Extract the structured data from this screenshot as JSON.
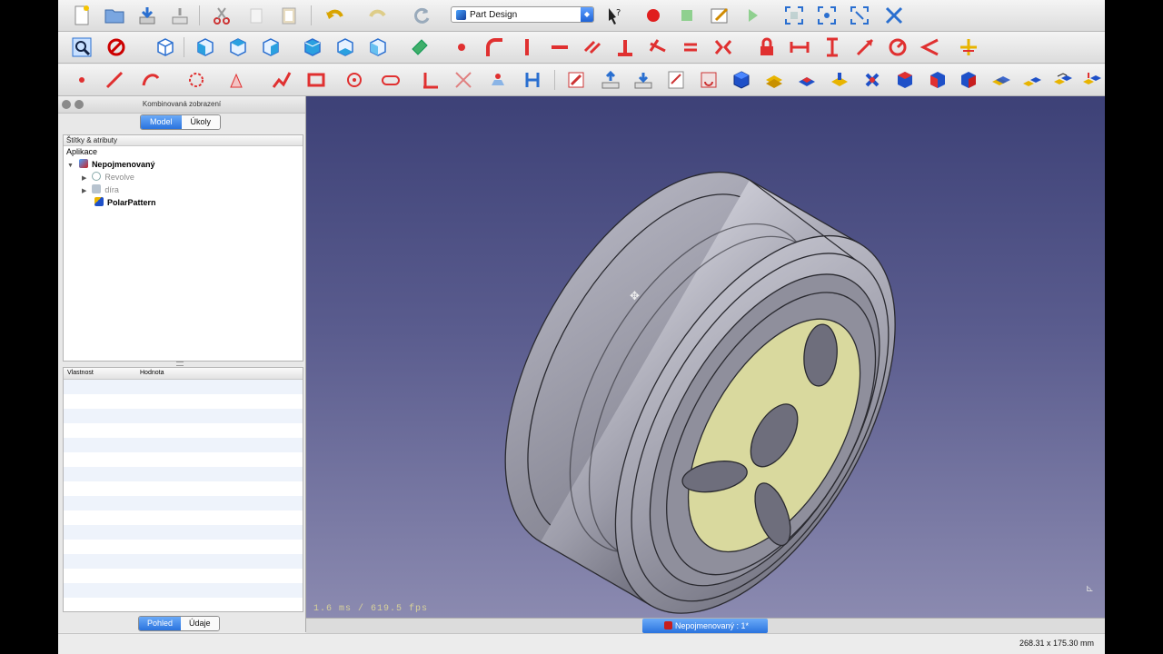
{
  "toolbar": {
    "workbench_selected": "Part Design"
  },
  "combo_view": {
    "title": "Kombinovaná zobrazení",
    "tabs": [
      "Model",
      "Úkoly"
    ],
    "active_tab": "Model",
    "tree_header": "Štítky & atributy",
    "tree_items": [
      {
        "label": "Aplikace",
        "icon": "none",
        "bold": false,
        "greyed": false
      },
      {
        "label": "Nepojmenovaný",
        "icon": "document-icon",
        "bold": true,
        "greyed": false
      },
      {
        "label": "Revolve",
        "icon": "revolve-icon",
        "bold": false,
        "greyed": true
      },
      {
        "label": "díra",
        "icon": "pocket-icon",
        "bold": false,
        "greyed": true
      },
      {
        "label": "PolarPattern",
        "icon": "polar-pattern-icon",
        "bold": true,
        "greyed": false
      }
    ],
    "property_columns": [
      "Vlastnost",
      "Hodnota"
    ],
    "bottom_tabs": [
      "Pohled",
      "Údaje"
    ],
    "bottom_active": "Pohled"
  },
  "viewport": {
    "fps_text": "1.6 ms / 619.5 fps"
  },
  "document_tab": {
    "label": "Nepojmenovaný : 1*"
  },
  "status_bar": {
    "dimensions": "268.31 x 175.30 mm"
  },
  "colors": {
    "accent": "#2a73de",
    "viewport_top": "#3d4177",
    "viewport_bottom": "#8b8ab0",
    "face_highlight": "#d9d99e"
  }
}
